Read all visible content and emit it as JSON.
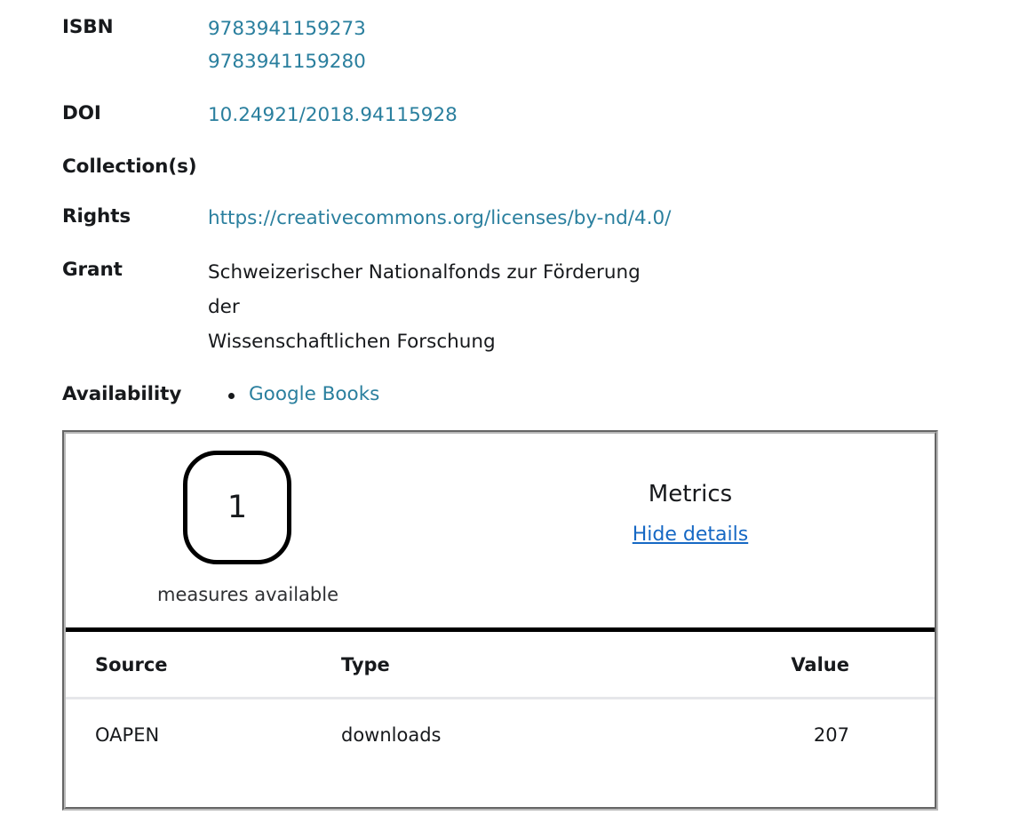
{
  "metadata": {
    "rows": [
      {
        "label": "ISBN",
        "type": "links",
        "values": [
          "9783941159273",
          "9783941159280"
        ]
      },
      {
        "label": "DOI",
        "type": "links",
        "values": [
          "10.24921/2018.94115928"
        ]
      },
      {
        "label": "Collection(s)",
        "type": "empty",
        "values": []
      },
      {
        "label": "Rights",
        "type": "links",
        "values": [
          "https://creativecommons.org/licenses/by-nd/4.0/"
        ]
      },
      {
        "label": "Grant",
        "type": "text",
        "values": [
          "Schweizerischer Nationalfonds zur Förderung der",
          "Wissenschaftlichen Forschung"
        ]
      },
      {
        "label": "Availability",
        "type": "bullet-links",
        "values": [
          "Google Books"
        ]
      }
    ]
  },
  "metrics": {
    "title": "Metrics",
    "toggle_label": "Hide details",
    "badge_count": "1",
    "badge_caption": "measures available",
    "table": {
      "headers": [
        "Source",
        "Type",
        "Value"
      ],
      "rows": [
        {
          "source": "OAPEN",
          "type": "downloads",
          "value": "207"
        }
      ]
    }
  },
  "colors": {
    "link": "#2a7f9e",
    "toggle_link": "#1668c4",
    "text": "#17191c",
    "rule": "#000000",
    "divider": "#e6e7ea",
    "panel_border": "#b9b9b9"
  }
}
